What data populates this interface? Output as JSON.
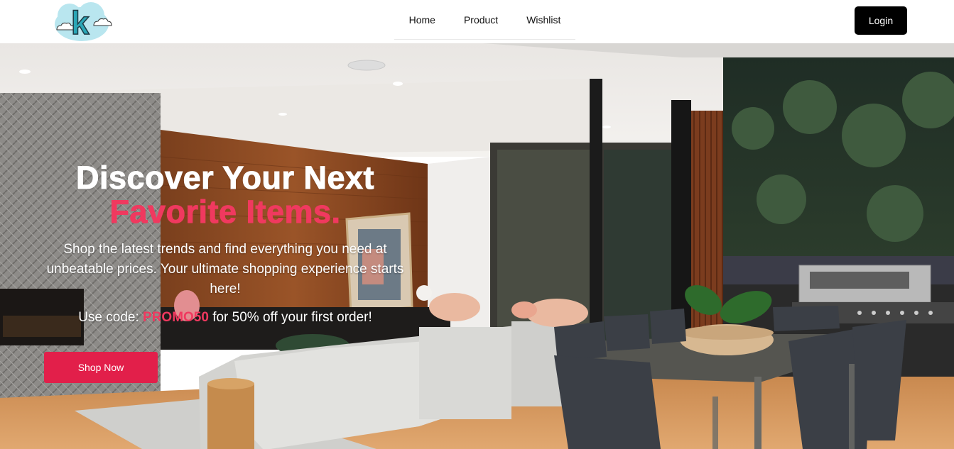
{
  "header": {
    "logo_letter": "k",
    "nav": [
      {
        "label": "Home"
      },
      {
        "label": "Product"
      },
      {
        "label": "Wishlist"
      }
    ],
    "login_label": "Login"
  },
  "hero": {
    "headline_line1": "Discover Your Next",
    "headline_line2": "Favorite Items.",
    "subtext": "Shop the latest trends and find everything you need at unbeatable prices. Your ultimate shopping experience starts here!",
    "promo_prefix": "Use code: ",
    "promo_code": "PROMO50",
    "promo_suffix": " for 50% off your first order!",
    "cta_label": "Shop Now"
  },
  "colors": {
    "accent": "#f0395f",
    "cta": "#e21f4a",
    "login_bg": "#000000"
  }
}
